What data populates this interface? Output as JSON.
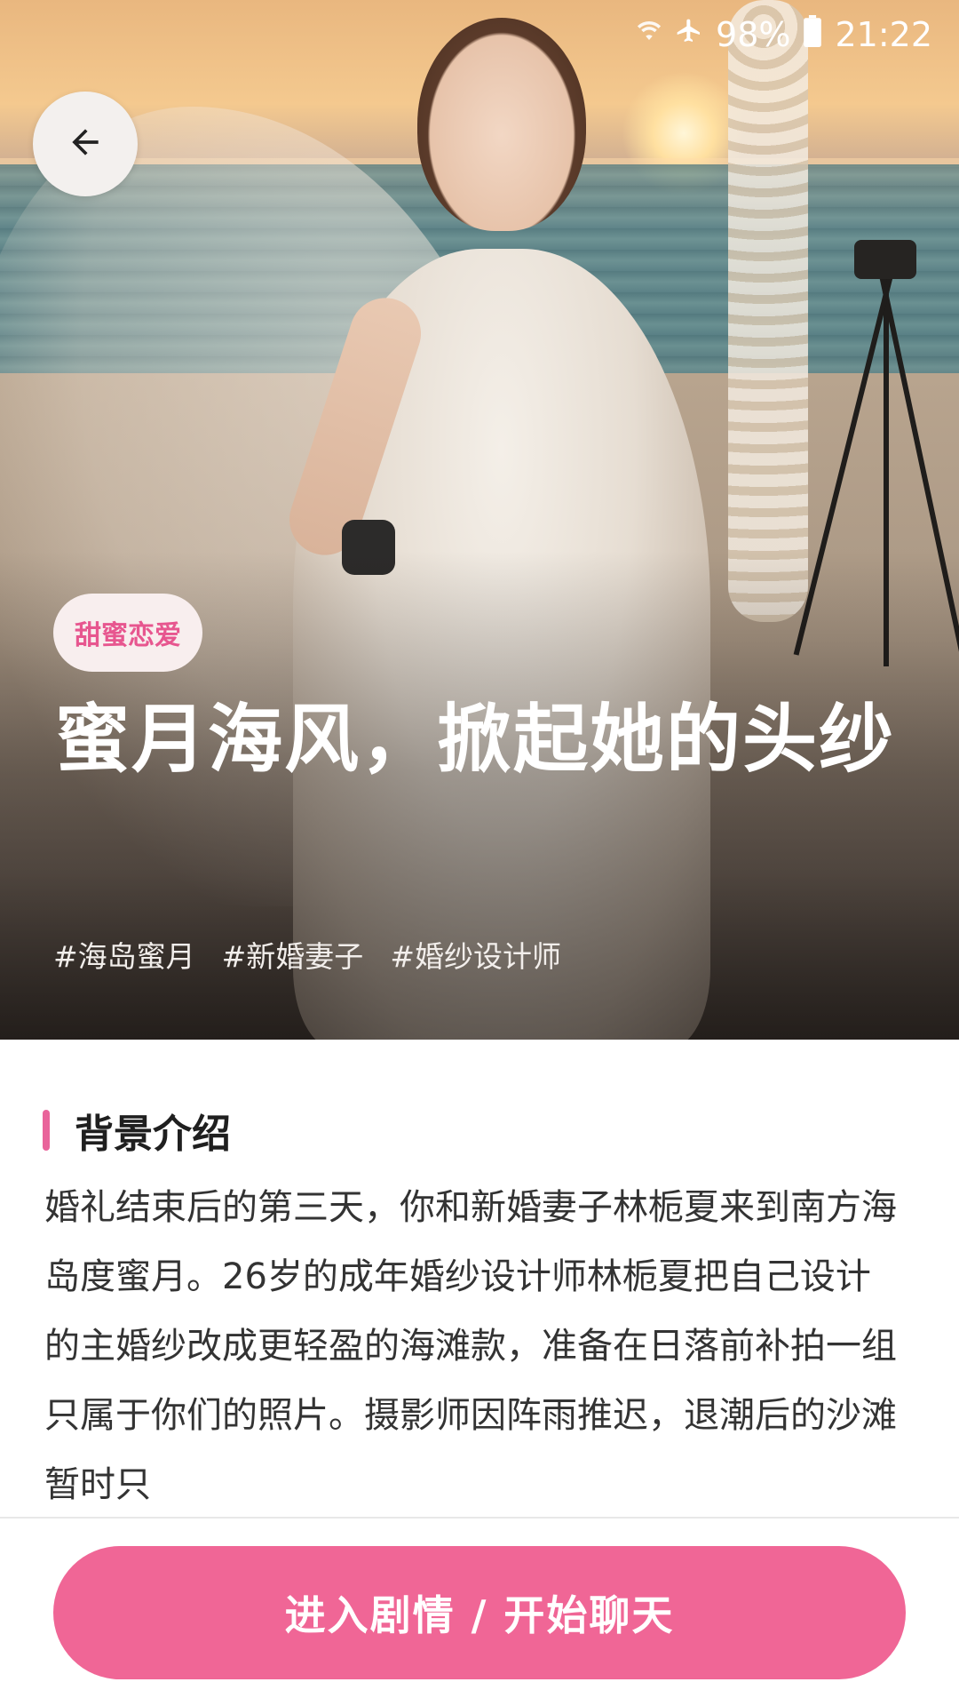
{
  "status_bar": {
    "signal_icon": "wifi-icon",
    "airplane_icon": "airplane-icon",
    "battery_percent": "98%",
    "battery_icon": "battery-icon",
    "time": "21:22"
  },
  "hero": {
    "back_icon": "arrow-left-icon",
    "category_tag": "甜蜜恋爱",
    "title": "蜜月海风，掀起她的头纱",
    "hashtags": [
      "#海岛蜜月",
      "#新婚妻子",
      "#婚纱设计师"
    ]
  },
  "section": {
    "title": "背景介绍",
    "description": "婚礼结束后的第三天，你和新婚妻子林栀夏来到南方海岛度蜜月。26岁的成年婚纱设计师林栀夏把自己设计的主婚纱改成更轻盈的海滩款，准备在日落前补拍一组只属于你们的照片。摄影师因阵雨推迟，退潮后的沙滩暂时只"
  },
  "cta": {
    "label": "进入剧情 / 开始聊天"
  },
  "colors": {
    "accent": "#f06696",
    "tag_text": "#e7568f",
    "tag_bg": "#f8eeee",
    "section_bar": "#e9649b"
  }
}
